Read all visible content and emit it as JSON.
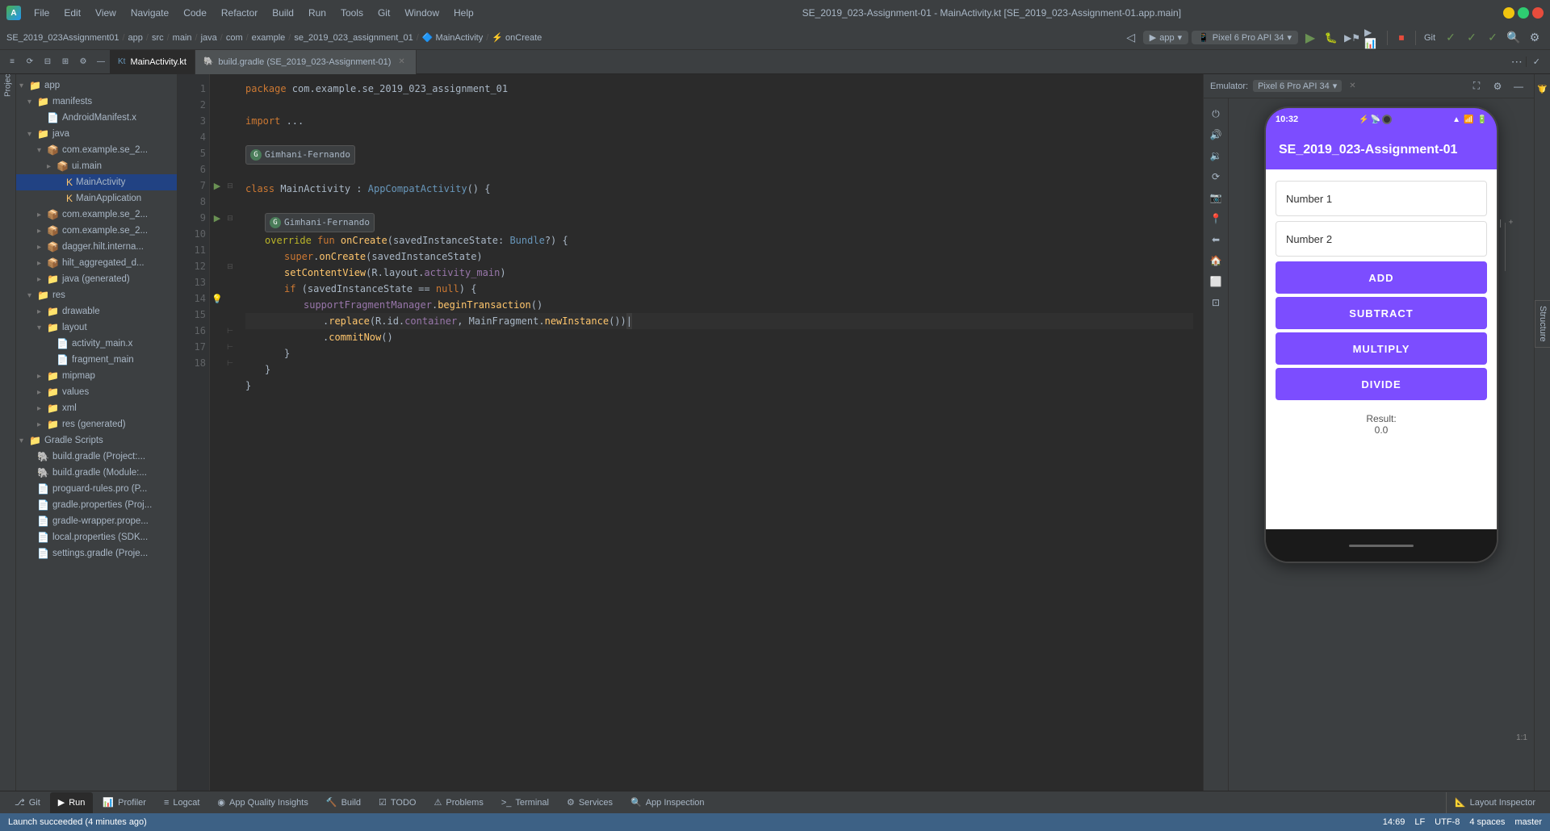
{
  "titleBar": {
    "appIcon": "A",
    "menuItems": [
      "File",
      "Edit",
      "View",
      "Navigate",
      "Code",
      "Refactor",
      "Build",
      "Run",
      "Tools",
      "Git",
      "Window",
      "Help"
    ],
    "title": "SE_2019_023-Assignment-01 - MainActivity.kt [SE_2019_023-Assignment-01.app.main]",
    "windowControls": {
      "minimize": "—",
      "maximize": "□",
      "close": "✕"
    }
  },
  "breadcrumb": {
    "items": [
      "SE_2019_023Assignment01",
      "app",
      "src",
      "main",
      "java",
      "com",
      "example",
      "se_2019_023_assignment_01",
      "MainActivity",
      "onCreate"
    ]
  },
  "tabs": [
    {
      "label": "MainActivity.kt",
      "active": true
    },
    {
      "label": "build.gradle (SE_2019_023-Assignment-01)",
      "active": false
    }
  ],
  "editor": {
    "filename": "MainActivity.kt",
    "lines": [
      {
        "num": 1,
        "content": "package com.example.se_2019_023_assignment_01"
      },
      {
        "num": 2,
        "content": ""
      },
      {
        "num": 3,
        "content": "import ..."
      },
      {
        "num": 4,
        "content": ""
      },
      {
        "num": 5,
        "content": ""
      },
      {
        "num": 6,
        "content": ""
      },
      {
        "num": 7,
        "content": "class MainActivity : AppCompatActivity() {"
      },
      {
        "num": 8,
        "content": ""
      },
      {
        "num": 9,
        "content": "    override fun onCreate(savedInstanceState: Bundle?) {"
      },
      {
        "num": 10,
        "content": "        super.onCreate(savedInstanceState)"
      },
      {
        "num": 11,
        "content": "        setContentView(R.layout.activity_main)"
      },
      {
        "num": 12,
        "content": "        if (savedInstanceState == null) {"
      },
      {
        "num": 13,
        "content": "            supportFragmentManager.beginTransaction()"
      },
      {
        "num": 14,
        "content": "                .replace(R.id.container, MainFragment.newInstance())"
      },
      {
        "num": 15,
        "content": "                .commitNow()"
      },
      {
        "num": 16,
        "content": "        }"
      },
      {
        "num": 17,
        "content": "    }"
      },
      {
        "num": 18,
        "content": "}"
      }
    ],
    "author": "Gimhani-Fernando",
    "cursorPosition": "14:69",
    "encoding": "UTF-8",
    "indentSize": "4 spaces",
    "lineEnding": "LF",
    "vcsStatus": "master"
  },
  "toolbar": {
    "leftButtons": [
      "≡",
      "↕",
      "↔",
      "⚙",
      "—"
    ],
    "rightButtons": [
      "⋯"
    ]
  },
  "emulator": {
    "label": "Emulator:",
    "device": "Pixel 6 Pro API 34",
    "phone": {
      "time": "10:32",
      "appTitle": "SE_2019_023-Assignment-01",
      "input1Placeholder": "Number 1",
      "input2Placeholder": "Number 2",
      "buttons": [
        "ADD",
        "SUBTRACT",
        "MULTIPLY",
        "DIVIDE"
      ],
      "resultLabel": "Result:",
      "resultValue": "0.0"
    }
  },
  "projectTree": {
    "items": [
      {
        "label": "app",
        "indent": 0,
        "expanded": true,
        "type": "folder"
      },
      {
        "label": "manifests",
        "indent": 1,
        "expanded": true,
        "type": "folder"
      },
      {
        "label": "AndroidManifest.x",
        "indent": 2,
        "expanded": false,
        "type": "file"
      },
      {
        "label": "java",
        "indent": 1,
        "expanded": true,
        "type": "folder"
      },
      {
        "label": "com.example.se_2...",
        "indent": 2,
        "expanded": true,
        "type": "package"
      },
      {
        "label": "ui.main",
        "indent": 3,
        "expanded": false,
        "type": "package"
      },
      {
        "label": "MainActivity",
        "indent": 4,
        "expanded": false,
        "type": "class"
      },
      {
        "label": "MainApplication",
        "indent": 4,
        "expanded": false,
        "type": "class"
      },
      {
        "label": "com.example.se_2...",
        "indent": 2,
        "expanded": false,
        "type": "package"
      },
      {
        "label": "com.example.se_2...",
        "indent": 2,
        "expanded": false,
        "type": "package"
      },
      {
        "label": "dagger.hilt.interna...",
        "indent": 2,
        "expanded": false,
        "type": "package"
      },
      {
        "label": "hilt_aggregated_d...",
        "indent": 2,
        "expanded": false,
        "type": "package"
      },
      {
        "label": "java (generated)",
        "indent": 2,
        "expanded": false,
        "type": "folder"
      },
      {
        "label": "res",
        "indent": 1,
        "expanded": true,
        "type": "folder"
      },
      {
        "label": "drawable",
        "indent": 2,
        "expanded": false,
        "type": "folder"
      },
      {
        "label": "layout",
        "indent": 2,
        "expanded": true,
        "type": "folder"
      },
      {
        "label": "activity_main.x",
        "indent": 3,
        "expanded": false,
        "type": "file"
      },
      {
        "label": "fragment_main",
        "indent": 3,
        "expanded": false,
        "type": "file"
      },
      {
        "label": "mipmap",
        "indent": 2,
        "expanded": false,
        "type": "folder"
      },
      {
        "label": "values",
        "indent": 2,
        "expanded": false,
        "type": "folder"
      },
      {
        "label": "xml",
        "indent": 2,
        "expanded": false,
        "type": "folder"
      },
      {
        "label": "res (generated)",
        "indent": 2,
        "expanded": false,
        "type": "folder"
      },
      {
        "label": "Gradle Scripts",
        "indent": 0,
        "expanded": true,
        "type": "folder"
      },
      {
        "label": "build.gradle (Project:...",
        "indent": 1,
        "expanded": false,
        "type": "file"
      },
      {
        "label": "build.gradle (Module:...",
        "indent": 1,
        "expanded": false,
        "type": "file"
      },
      {
        "label": "proguard-rules.pro (P...",
        "indent": 1,
        "expanded": false,
        "type": "file"
      },
      {
        "label": "gradle.properties (Proj...",
        "indent": 1,
        "expanded": false,
        "type": "file"
      },
      {
        "label": "gradle-wrapper.prope...",
        "indent": 1,
        "expanded": false,
        "type": "file"
      },
      {
        "label": "local.properties (SDK...",
        "indent": 1,
        "expanded": false,
        "type": "file"
      },
      {
        "label": "settings.gradle (Proje...",
        "indent": 1,
        "expanded": false,
        "type": "file"
      }
    ]
  },
  "bottomTabs": [
    {
      "label": "Git",
      "icon": "⎇"
    },
    {
      "label": "Run",
      "icon": "▶"
    },
    {
      "label": "Profiler",
      "icon": "📊"
    },
    {
      "label": "Logcat",
      "icon": "≡"
    },
    {
      "label": "App Quality Insights",
      "icon": "◉"
    },
    {
      "label": "Build",
      "icon": "🔨"
    },
    {
      "label": "TODO",
      "icon": "☑"
    },
    {
      "label": "Problems",
      "icon": "⚠"
    },
    {
      "label": "Terminal",
      "icon": ">_"
    },
    {
      "label": "Services",
      "icon": "⚙"
    },
    {
      "label": "App Inspection",
      "icon": "🔍"
    }
  ],
  "rightBottomTabs": [
    {
      "label": "Layout Inspector",
      "icon": "📐"
    }
  ],
  "statusBar": {
    "message": "Launch succeeded (4 minutes ago)",
    "cursorPosition": "14:69",
    "lineEnding": "LF",
    "encoding": "UTF-8",
    "indentInfo": "4 spaces",
    "vcs": "master"
  },
  "colors": {
    "accent": "#7c4dff",
    "background": "#2b2b2b",
    "sidebar": "#3c3f41",
    "keyword": "#cc7832",
    "function": "#ffc66d",
    "string": "#6a8759",
    "comment": "#808080",
    "number": "#6897bb"
  }
}
